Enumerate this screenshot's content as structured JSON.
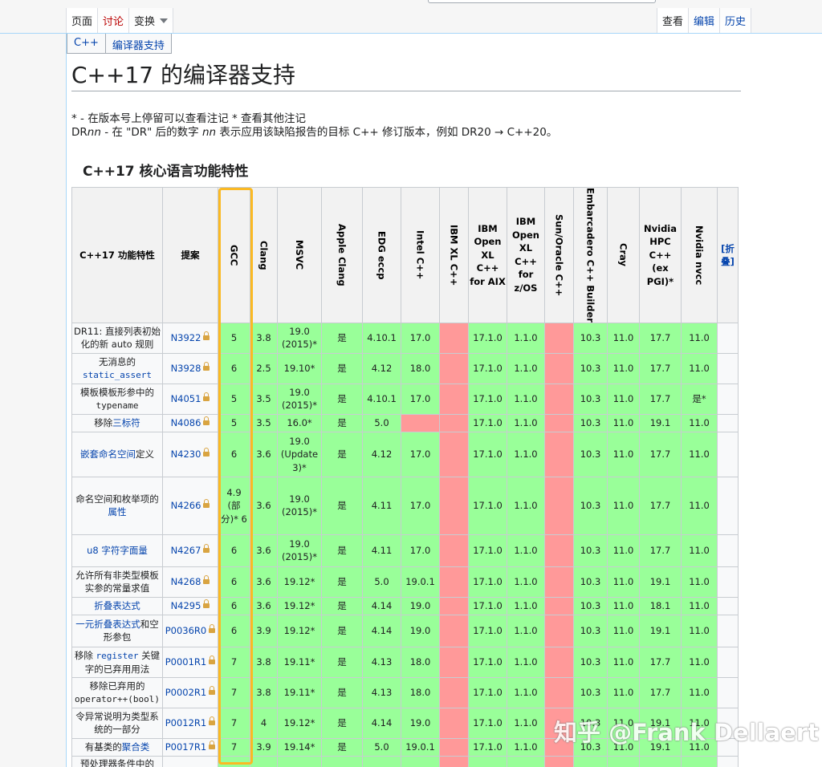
{
  "tabs_left": [
    {
      "label": "页面",
      "kind": "active"
    },
    {
      "label": "讨论",
      "kind": "talk"
    },
    {
      "label": "变换",
      "kind": "menu"
    }
  ],
  "tabs_right": [
    "查看",
    "编辑",
    "历史"
  ],
  "breadcrumbs": [
    "C++",
    "编译器支持"
  ],
  "page_title": "C++17 的编译器支持",
  "notes": {
    "line1": "* - 在版本号上停留可以查看注记 * 查看其他注记",
    "line2_prefix": "DR",
    "line2_nn": "nn",
    "line2_mid": " - 在 \"DR\" 后的数字 ",
    "line2_nn2": "nn",
    "line2_suffix": " 表示应用该缺陷报告的目标 C++ 修订版本，例如 DR20 → C++20。"
  },
  "section_title": "C++17 核心语言功能特性",
  "table": {
    "header_feature": "C++17 功能特性",
    "header_paper": "提案",
    "compilers_vertical_1": [
      "GCC",
      "Clang",
      "MSVC",
      "Apple Clang",
      "EDG eccp",
      "Intel C++",
      "IBM XL C++"
    ],
    "ibm_open_aix": "IBM Open XL C++ for AIX",
    "ibm_open_zos": "IBM Open XL C++ for z/OS",
    "compilers_vertical_2": [
      "Sun/Oracle C++",
      "Embarcadero C++ Builder",
      "Cray"
    ],
    "nvidia_hpc": "Nvidia HPC C++ (ex PGI)*",
    "nvidia_nvcc": "Nvidia nvcc",
    "collapse_label": "[折叠]",
    "rows": [
      {
        "feature": "DR11: 直接列表初始化的新 auto 规则",
        "paper": "N3922",
        "cells": [
          "5",
          "3.8",
          "19.0 (2015)*",
          "是",
          "4.10.1",
          "17.0",
          "",
          "17.1.0",
          "1.1.0",
          "",
          "10.3",
          "11.0",
          "17.7",
          "11.0"
        ],
        "status": [
          "y",
          "y",
          "y",
          "y",
          "y",
          "y",
          "n",
          "y",
          "y",
          "n",
          "y",
          "y",
          "y",
          "y"
        ]
      },
      {
        "feature": "无消息的 static_assert",
        "paper": "N3928",
        "cells": [
          "6",
          "2.5",
          "19.10*",
          "是",
          "4.12",
          "18.0",
          "",
          "17.1.0",
          "1.1.0",
          "",
          "10.3",
          "11.0",
          "17.7",
          "11.0"
        ],
        "status": [
          "y",
          "y",
          "y",
          "y",
          "y",
          "y",
          "n",
          "y",
          "y",
          "n",
          "y",
          "y",
          "y",
          "y"
        ]
      },
      {
        "feature": "模板模板形参中的 typename",
        "paper": "N4051",
        "cells": [
          "5",
          "3.5",
          "19.0 (2015)*",
          "是",
          "4.10.1",
          "17.0",
          "",
          "17.1.0",
          "1.1.0",
          "",
          "10.3",
          "11.0",
          "17.7",
          "是*"
        ],
        "status": [
          "y",
          "y",
          "y",
          "y",
          "y",
          "y",
          "n",
          "y",
          "y",
          "n",
          "y",
          "y",
          "y",
          "y"
        ]
      },
      {
        "feature": "移除三标符",
        "paper": "N4086",
        "cells": [
          "5",
          "3.5",
          "16.0*",
          "是",
          "5.0",
          "",
          "",
          "17.1.0",
          "1.1.0",
          "",
          "10.3",
          "11.0",
          "19.1",
          "11.0"
        ],
        "status": [
          "y",
          "y",
          "y",
          "y",
          "y",
          "n",
          "n",
          "y",
          "y",
          "n",
          "y",
          "y",
          "y",
          "y"
        ]
      },
      {
        "feature": "嵌套命名空间定义",
        "paper": "N4230",
        "cells": [
          "6",
          "3.6",
          "19.0 (Update 3)*",
          "是",
          "4.12",
          "17.0",
          "",
          "17.1.0",
          "1.1.0",
          "",
          "10.3",
          "11.0",
          "17.7",
          "11.0"
        ],
        "status": [
          "y",
          "y",
          "y",
          "y",
          "y",
          "y",
          "n",
          "y",
          "y",
          "n",
          "y",
          "y",
          "y",
          "y"
        ]
      },
      {
        "feature": "命名空间和枚举项的属性",
        "paper": "N4266",
        "cells": [
          "4.9 (部分)* 6",
          "3.6",
          "19.0 (2015)*",
          "是",
          "4.11",
          "17.0",
          "",
          "17.1.0",
          "1.1.0",
          "",
          "10.3",
          "11.0",
          "17.7",
          "11.0"
        ],
        "status": [
          "y",
          "y",
          "y",
          "y",
          "y",
          "y",
          "n",
          "y",
          "y",
          "n",
          "y",
          "y",
          "y",
          "y"
        ]
      },
      {
        "feature": "u8 字符字面量",
        "paper": "N4267",
        "cells": [
          "6",
          "3.6",
          "19.0 (2015)*",
          "是",
          "4.11",
          "17.0",
          "",
          "17.1.0",
          "1.1.0",
          "",
          "10.3",
          "11.0",
          "17.7",
          "11.0"
        ],
        "status": [
          "y",
          "y",
          "y",
          "y",
          "y",
          "y",
          "n",
          "y",
          "y",
          "n",
          "y",
          "y",
          "y",
          "y"
        ]
      },
      {
        "feature": "允许所有非类型模板实参的常量求值",
        "paper": "N4268",
        "cells": [
          "6",
          "3.6",
          "19.12*",
          "是",
          "5.0",
          "19.0.1",
          "",
          "17.1.0",
          "1.1.0",
          "",
          "10.3",
          "11.0",
          "19.1",
          "11.0"
        ],
        "status": [
          "y",
          "y",
          "y",
          "y",
          "y",
          "y",
          "n",
          "y",
          "y",
          "n",
          "y",
          "y",
          "y",
          "y"
        ]
      },
      {
        "feature": "折叠表达式",
        "paper": "N4295",
        "cells": [
          "6",
          "3.6",
          "19.12*",
          "是",
          "4.14",
          "19.0",
          "",
          "17.1.0",
          "1.1.0",
          "",
          "10.3",
          "11.0",
          "18.1",
          "11.0"
        ],
        "status": [
          "y",
          "y",
          "y",
          "y",
          "y",
          "y",
          "n",
          "y",
          "y",
          "n",
          "y",
          "y",
          "y",
          "y"
        ]
      },
      {
        "feature": "一元折叠表达式和空形参包",
        "paper": "P0036R0",
        "cells": [
          "6",
          "3.9",
          "19.12*",
          "是",
          "4.14",
          "19.0",
          "",
          "17.1.0",
          "1.1.0",
          "",
          "10.3",
          "11.0",
          "19.1",
          "11.0"
        ],
        "status": [
          "y",
          "y",
          "y",
          "y",
          "y",
          "y",
          "n",
          "y",
          "y",
          "n",
          "y",
          "y",
          "y",
          "y"
        ]
      },
      {
        "feature": "移除 register 关键字的已弃用用法",
        "paper": "P0001R1",
        "cells": [
          "7",
          "3.8",
          "19.11*",
          "是",
          "4.13",
          "18.0",
          "",
          "17.1.0",
          "1.1.0",
          "",
          "10.3",
          "11.0",
          "17.7",
          "11.0"
        ],
        "status": [
          "y",
          "y",
          "y",
          "y",
          "y",
          "y",
          "n",
          "y",
          "y",
          "n",
          "y",
          "y",
          "y",
          "y"
        ]
      },
      {
        "feature": "移除已弃用的 operator++(bool)",
        "paper": "P0002R1",
        "cells": [
          "7",
          "3.8",
          "19.11*",
          "是",
          "4.13",
          "18.0",
          "",
          "17.1.0",
          "1.1.0",
          "",
          "10.3",
          "11.0",
          "17.7",
          "11.0"
        ],
        "status": [
          "y",
          "y",
          "y",
          "y",
          "y",
          "y",
          "n",
          "y",
          "y",
          "n",
          "y",
          "y",
          "y",
          "y"
        ]
      },
      {
        "feature": "令异常说明为类型系统的一部分",
        "paper": "P0012R1",
        "cells": [
          "7",
          "4",
          "19.12*",
          "是",
          "4.14",
          "19.0",
          "",
          "17.1.0",
          "1.1.0",
          "",
          "10.3",
          "11.0",
          "19.1",
          "11.0"
        ],
        "status": [
          "y",
          "y",
          "y",
          "y",
          "y",
          "y",
          "n",
          "y",
          "y",
          "n",
          "y",
          "y",
          "y",
          "y"
        ]
      },
      {
        "feature": "有基类的聚合类",
        "paper": "P0017R1",
        "cells": [
          "7",
          "3.9",
          "19.14*",
          "是",
          "5.0",
          "19.0.1",
          "",
          "17.1.0",
          "1.1.0",
          "",
          "10.3",
          "11.0",
          "19.1",
          "11.0"
        ],
        "status": [
          "y",
          "y",
          "y",
          "y",
          "y",
          "y",
          "n",
          "y",
          "y",
          "n",
          "y",
          "y",
          "y",
          "y"
        ]
      },
      {
        "feature": "预处理器条件中的",
        "paper": "",
        "cells": [
          "",
          "",
          "",
          "",
          "",
          "",
          "",
          "",
          "",
          "",
          "",
          "",
          "",
          ""
        ],
        "status": [
          "y",
          "y",
          "y",
          "y",
          "y",
          "y",
          "n",
          "y",
          "y",
          "n",
          "y",
          "y",
          "y",
          "y"
        ]
      }
    ]
  },
  "watermark": "知乎 @Frank Dellaert",
  "colors": {
    "supported": "#99ff99",
    "unsupported": "#ff9999",
    "highlight": "#fbb923",
    "link": "#0645ad"
  }
}
